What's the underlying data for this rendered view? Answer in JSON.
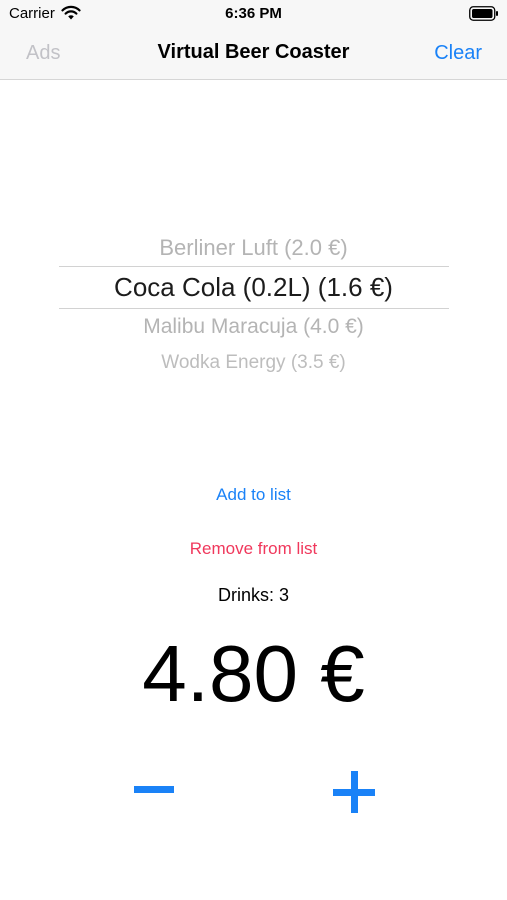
{
  "status_bar": {
    "carrier": "Carrier",
    "time": "6:36 PM",
    "icons": [
      "wifi-icon",
      "battery-icon"
    ]
  },
  "nav": {
    "left_label": "Ads",
    "title": "Virtual Beer Coaster",
    "right_label": "Clear"
  },
  "picker": {
    "rows": [
      "Berliner Luft (2.0 €)",
      "Coca Cola (0.2L) (1.6 €)",
      "Malibu Maracuja (4.0 €)",
      "Wodka Energy (3.5 €)"
    ],
    "selected": "Coca Cola (0.2L) (1.6 €)"
  },
  "actions": {
    "add_label": "Add to list",
    "remove_label": "Remove from list"
  },
  "summary": {
    "drinks_label": "Drinks:",
    "drinks_count": "3",
    "total": "4.80 €"
  },
  "stepper": {
    "minus_icon": "minus-icon",
    "plus_icon": "plus-icon"
  },
  "colors": {
    "accent": "#1a82f7",
    "destructive": "#f0385c",
    "disabled": "#c2c2c7"
  }
}
